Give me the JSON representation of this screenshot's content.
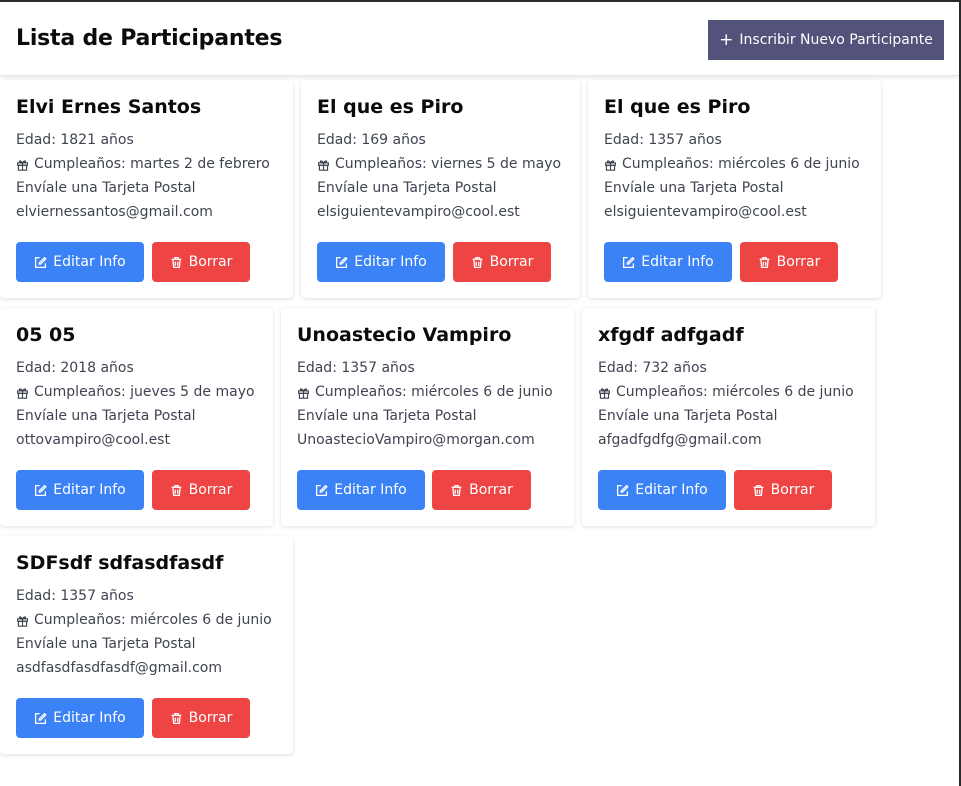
{
  "header": {
    "title": "Lista de Participantes",
    "add_button_label": "Inscribir Nuevo Participante",
    "add_button_icon": "plus-icon"
  },
  "colors": {
    "header_button": "#52527a",
    "edit_button": "#3b82f6",
    "delete_button": "#ef4444"
  },
  "participants": [
    {
      "name": "Elvi Ernes Santos",
      "age": "Edad: 1821 años",
      "birthday": "Cumpleaños: martes 2 de febrero",
      "postcard": "Envíale una Tarjeta Postal",
      "email": "elviernessantos@gmail.com",
      "edit_label": "Editar Info",
      "delete_label": "Borrar"
    },
    {
      "name": "El que es Piro",
      "age": "Edad: 169 años",
      "birthday": "Cumpleaños: viernes 5 de mayo",
      "postcard": "Envíale una Tarjeta Postal",
      "email": "elsiguientevampiro@cool.est",
      "edit_label": "Editar Info",
      "delete_label": "Borrar"
    },
    {
      "name": "El que es Piro",
      "age": "Edad: 1357 años",
      "birthday": "Cumpleaños: miércoles 6 de junio",
      "postcard": "Envíale una Tarjeta Postal",
      "email": "elsiguientevampiro@cool.est",
      "edit_label": "Editar Info",
      "delete_label": "Borrar"
    },
    {
      "name": "05 05",
      "age": "Edad: 2018 años",
      "birthday": "Cumpleaños: jueves 5 de mayo",
      "postcard": "Envíale una Tarjeta Postal",
      "email": "ottovampiro@cool.est",
      "edit_label": "Editar Info",
      "delete_label": "Borrar"
    },
    {
      "name": "Unoastecio Vampiro",
      "age": "Edad: 1357 años",
      "birthday": "Cumpleaños: miércoles 6 de junio",
      "postcard": "Envíale una Tarjeta Postal",
      "email": "UnoastecioVampiro@morgan.com",
      "edit_label": "Editar Info",
      "delete_label": "Borrar"
    },
    {
      "name": "xfgdf adfgadf",
      "age": "Edad: 732 años",
      "birthday": "Cumpleaños: miércoles 6 de junio",
      "postcard": "Envíale una Tarjeta Postal",
      "email": "afgadfgdfg@gmail.com",
      "edit_label": "Editar Info",
      "delete_label": "Borrar"
    },
    {
      "name": "SDFsdf sdfasdfasdf",
      "age": "Edad: 1357 años",
      "birthday": "Cumpleaños: miércoles 6 de junio",
      "postcard": "Envíale una Tarjeta Postal",
      "email": "asdfasdfasdfasdf@gmail.com",
      "edit_label": "Editar Info",
      "delete_label": "Borrar"
    }
  ],
  "icons": {
    "birthday": "gift-icon",
    "edit": "edit-icon",
    "delete": "trash-icon"
  }
}
